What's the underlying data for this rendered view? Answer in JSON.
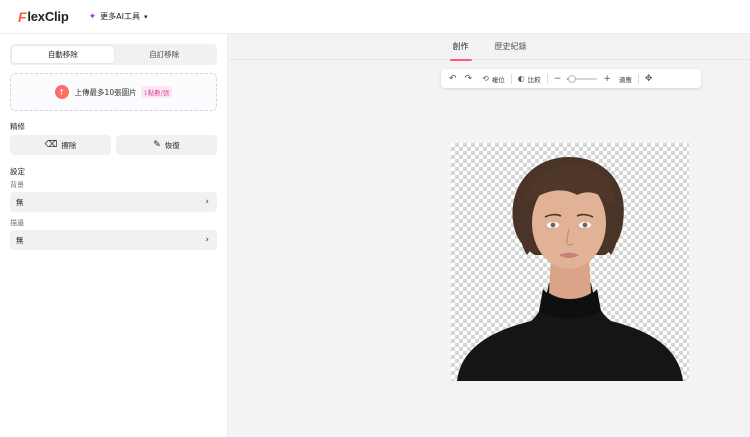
{
  "header": {
    "logo_f": "F",
    "logo_rest": "lexClip",
    "more_tools_label": "更多AI工具"
  },
  "left_panel": {
    "modes": [
      {
        "label": "自動移除",
        "active": true
      },
      {
        "label": "自訂移除",
        "active": false
      }
    ],
    "upload": {
      "text": "上傳最多10張圖片",
      "badge": "1點數/張"
    },
    "refine": {
      "section_label": "精修",
      "erase_label": "擦除",
      "restore_label": "恢復"
    },
    "settings": {
      "section_label": "設定",
      "background_label": "背景",
      "background_value": "無",
      "stroke_label": "描邊",
      "stroke_value": "無"
    }
  },
  "tabs": [
    {
      "label": "創作",
      "active": true
    },
    {
      "label": "歷史紀錄",
      "active": false
    }
  ],
  "toolbar": {
    "reset_label": "複位",
    "compare_label": "比較",
    "zoom_level": 0.15,
    "fit_label": "適應"
  },
  "colors": {
    "brand_orange": "#ff5a3c",
    "accent_pink": "#ff5a7a",
    "ai_purple": "#a23be8"
  }
}
